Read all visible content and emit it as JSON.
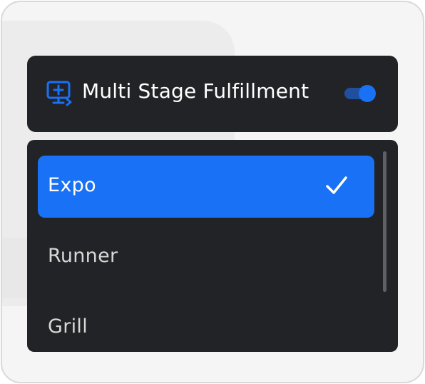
{
  "header": {
    "icon": "monitor-plus-icon",
    "title": "Multi Stage Fulfillment",
    "toggle_on": true
  },
  "stages": {
    "options": [
      {
        "label": "Expo",
        "selected": true
      },
      {
        "label": "Runner",
        "selected": false
      },
      {
        "label": "Grill",
        "selected": false
      }
    ],
    "selected_icon": "checkmark-icon"
  },
  "colors": {
    "panel": "#222326",
    "accent": "#1971f5",
    "toggle_track": "#1f4f9e",
    "text_primary": "#ffffff",
    "text_muted": "#d8d8d8",
    "frame_bg": "#f5f5f5"
  }
}
